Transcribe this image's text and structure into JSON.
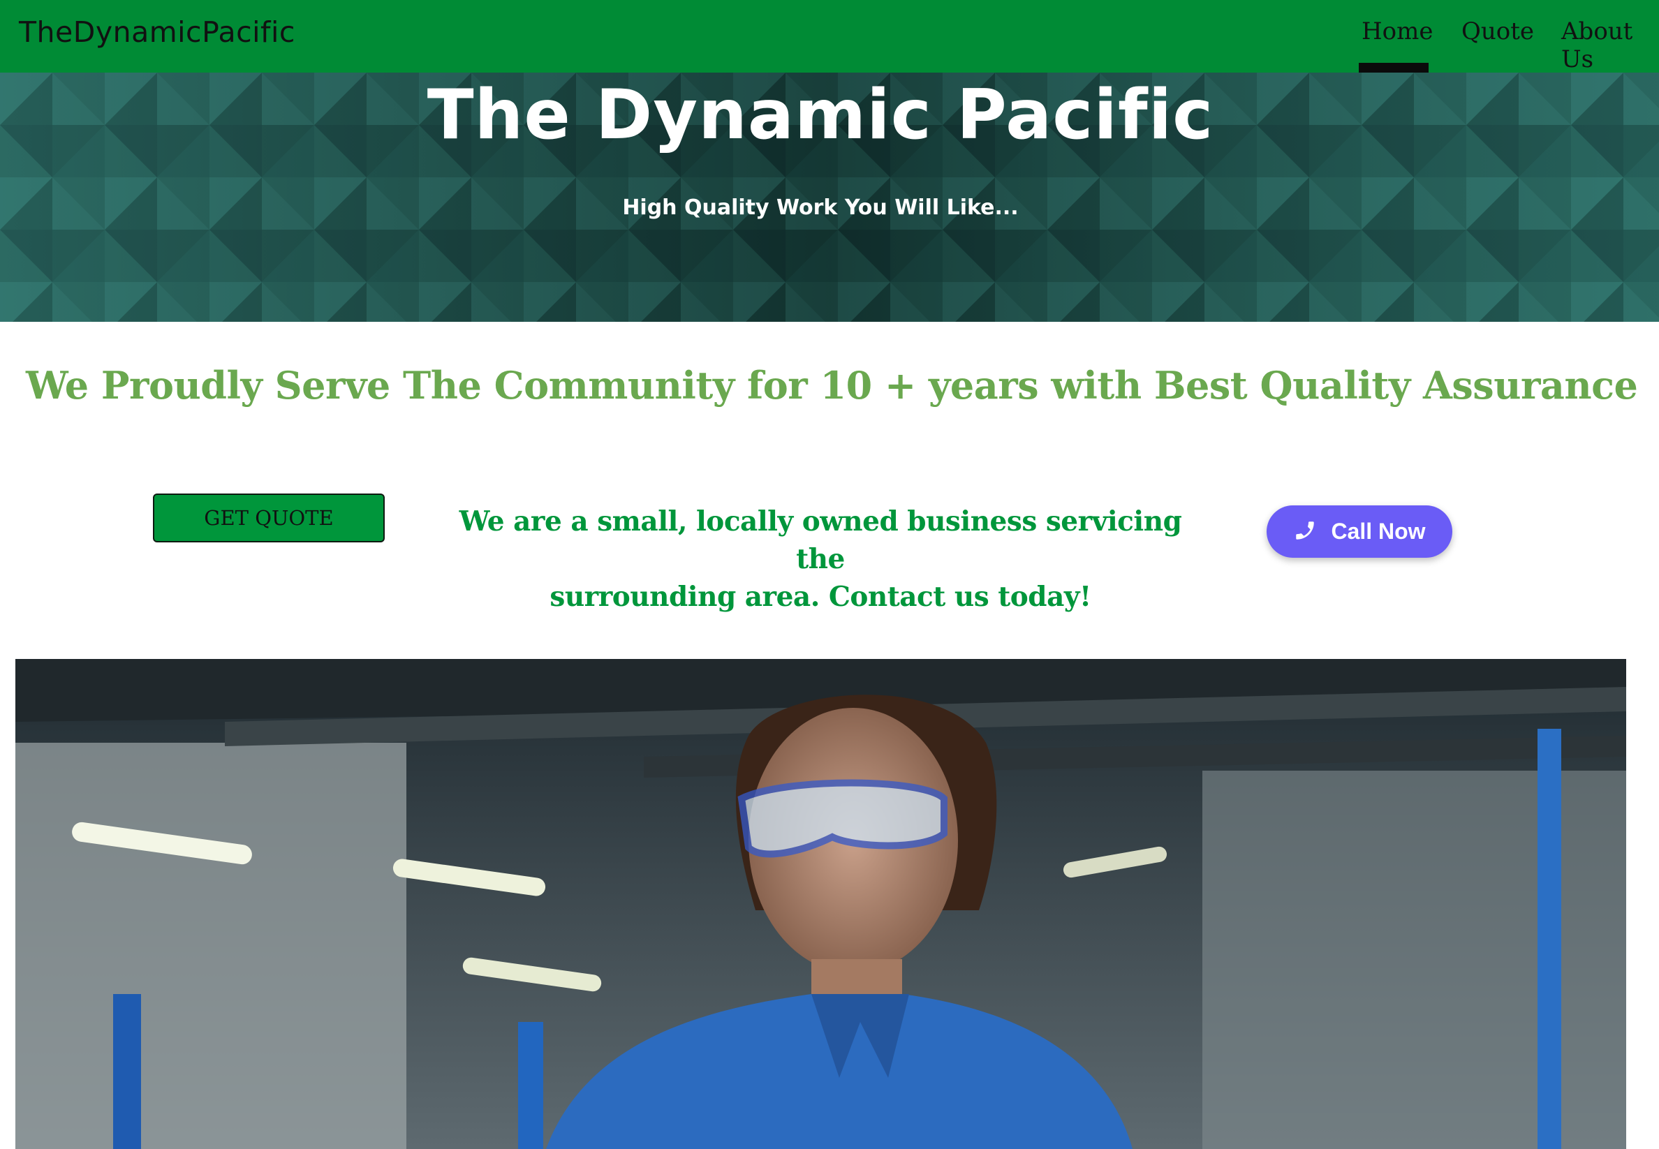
{
  "navbar": {
    "brand": "TheDynamicPacific",
    "links": [
      {
        "label": "Home",
        "active": true
      },
      {
        "label": "Quote",
        "active": false
      },
      {
        "label": "About Us",
        "active": false
      }
    ],
    "background_color": "#008b35"
  },
  "hero": {
    "title": "The Dynamic Pacific",
    "subtitle": "High Quality Work You Will Like..."
  },
  "main": {
    "headline": "We Proudly Serve The Community for 10 + years with Best Quality Assurance",
    "quote_button": "GET QUOTE",
    "intro_line1": "We are a small, locally owned business servicing the",
    "intro_line2": "surrounding area. Contact us today!",
    "call_button": "Call Now",
    "call_icon": "phone-icon",
    "accent_color": "#00963b",
    "headline_color": "#6aa84f",
    "call_color": "#6a5cf6"
  },
  "photo": {
    "subject": "mechanic-with-safety-goggles-photo"
  }
}
